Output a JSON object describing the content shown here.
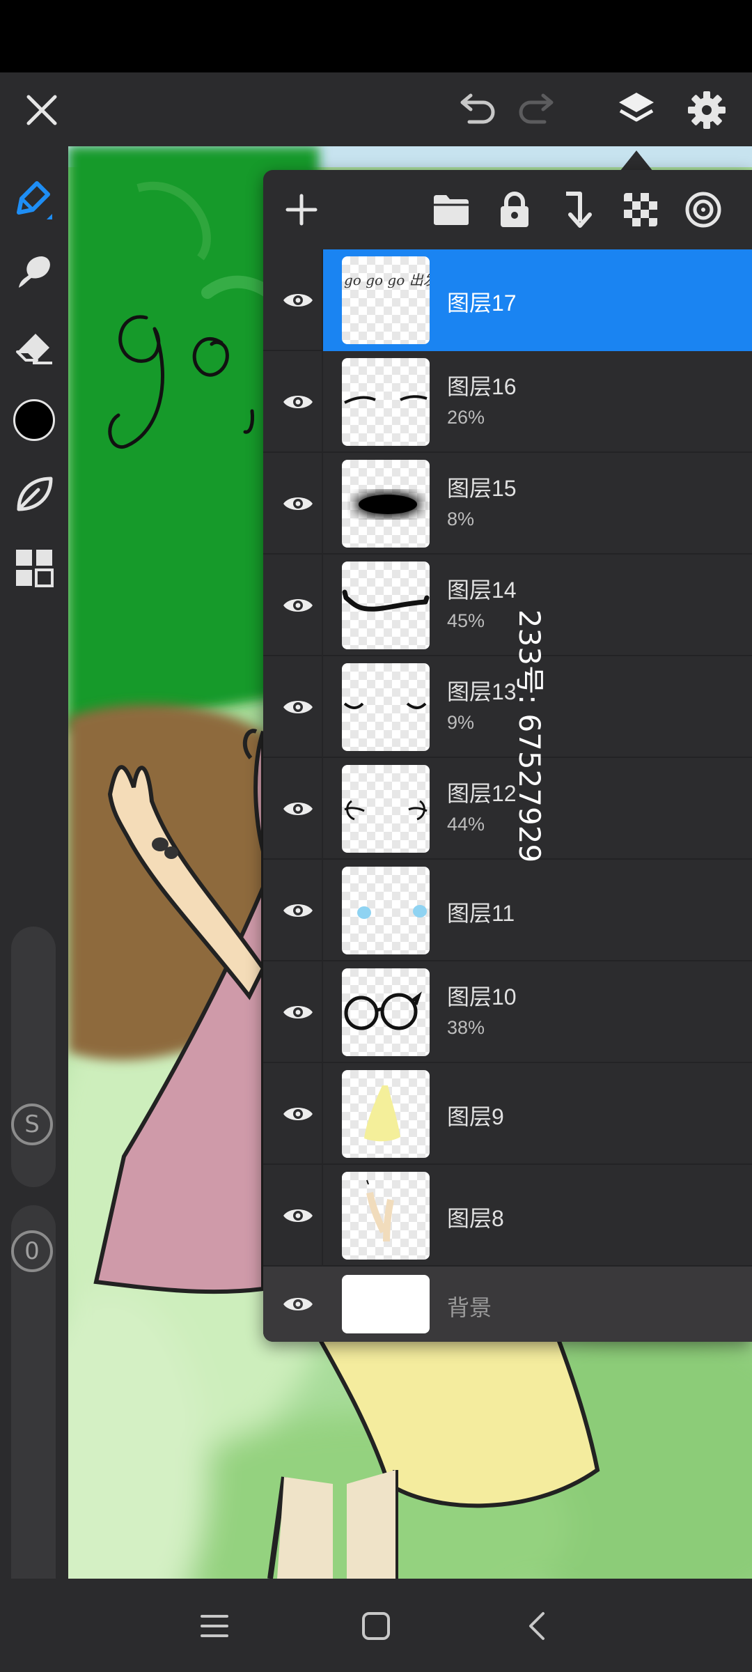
{
  "toolbar": {
    "close_icon": "close-icon",
    "undo_icon": "undo-icon",
    "redo_icon": "redo-icon",
    "layers_icon": "layers-icon",
    "settings_icon": "gear-icon"
  },
  "tools": [
    {
      "name": "pen",
      "icon": "pen-icon",
      "active": true
    },
    {
      "name": "smudge",
      "icon": "smudge-icon"
    },
    {
      "name": "eraser",
      "icon": "eraser-icon"
    },
    {
      "name": "color",
      "icon": "color-swatch",
      "color": "#000000"
    },
    {
      "name": "liquify",
      "icon": "leaf-icon"
    },
    {
      "name": "gallery",
      "icon": "grid-icon"
    }
  ],
  "brush_size_button": "S",
  "opacity_button": "0",
  "layers_panel": {
    "toolbar_icons": [
      "plus-icon",
      "folder-icon",
      "lock-icon",
      "merge-down-icon",
      "checker-icon",
      "target-icon"
    ],
    "layers": [
      {
        "name": "图层17",
        "opacity": "",
        "selected": true,
        "visible": true
      },
      {
        "name": "图层16",
        "opacity": "26%",
        "visible": true
      },
      {
        "name": "图层15",
        "opacity": "8%",
        "visible": true
      },
      {
        "name": "图层14",
        "opacity": "45%",
        "visible": true
      },
      {
        "name": "图层13",
        "opacity": "9%",
        "visible": true
      },
      {
        "name": "图层12",
        "opacity": "44%",
        "visible": true
      },
      {
        "name": "图层11",
        "opacity": "",
        "visible": true
      },
      {
        "name": "图层10",
        "opacity": "38%",
        "visible": true
      },
      {
        "name": "图层9",
        "opacity": "",
        "visible": true
      },
      {
        "name": "图层8",
        "opacity": "",
        "visible": true
      }
    ],
    "background_layer": {
      "name": "背景",
      "visible": true
    }
  },
  "canvas": {
    "handwritten_text": "go",
    "watermark": "233号: 67527929",
    "thumbnail_text_17": "go go go 出发咯"
  },
  "navbar": {
    "menu_icon": "menu-icon",
    "home_icon": "home-icon",
    "back_icon": "back-icon"
  },
  "colors": {
    "accent": "#1a84f2",
    "toolbar_bg": "#2b2b2d",
    "panel_bg": "#2c2c2e"
  }
}
